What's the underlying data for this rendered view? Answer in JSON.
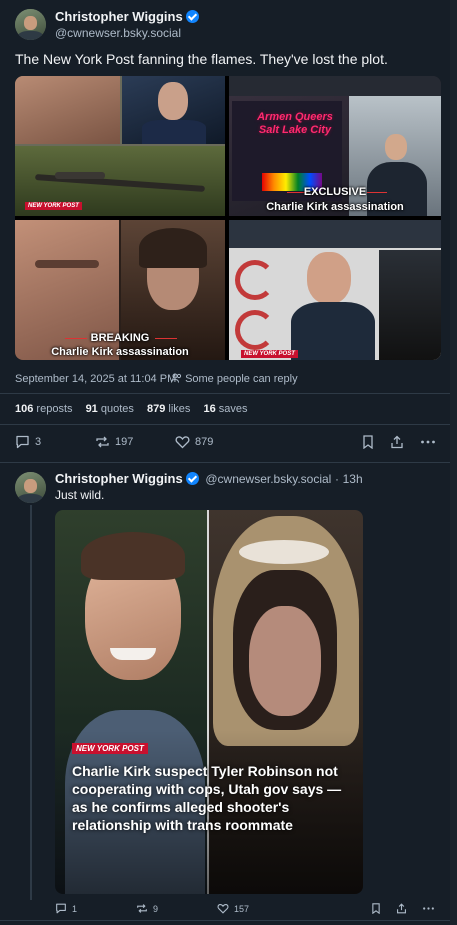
{
  "main_post": {
    "author_name": "Christopher Wiggins",
    "author_handle": "@cwnewser.bsky.social",
    "text": "The New York Post fanning the flames. They've lost the plot.",
    "images": {
      "cell2_sign_line1": "Armen Queers",
      "cell2_sign_line2": "Salt Lake City",
      "cell2_caption_label": "EXCLUSIVE",
      "cell2_caption_title": "Charlie Kirk assassination",
      "cell1_brand": "NEW YORK POST",
      "cell3_caption_label": "BREAKING",
      "cell3_caption_title": "Charlie Kirk assassination",
      "cell4_brand": "NEW YORK POST"
    },
    "timestamp": "September 14, 2025 at 11:04 PM",
    "reply_restriction": "Some people can reply",
    "stats": {
      "reposts_count": "106",
      "reposts_label": "reposts",
      "quotes_count": "91",
      "quotes_label": "quotes",
      "likes_count": "879",
      "likes_label": "likes",
      "saves_count": "16",
      "saves_label": "saves"
    },
    "actions": {
      "replies": "3",
      "reposts": "197",
      "likes": "879"
    }
  },
  "reply_post": {
    "author_name": "Christopher Wiggins",
    "author_handle": "@cwnewser.bsky.social",
    "separator": "·",
    "age": "13h",
    "text": "Just wild.",
    "image": {
      "brand": "NEW YORK POST",
      "headline": "Charlie Kirk suspect Tyler Robinson not cooperating with cops, Utah gov says — as he confirms alleged shooter's relationship with trans roommate"
    },
    "actions": {
      "replies": "1",
      "reposts": "9",
      "likes": "157"
    }
  },
  "colors": {
    "background": "#161e27",
    "accent": "#1185fe",
    "muted_text": "#aebbc9",
    "divider": "#2e3a46",
    "brand_red": "#c8102e"
  },
  "icons": [
    "verified-badge-icon",
    "people-icon",
    "reply-icon",
    "repost-icon",
    "like-icon",
    "bookmark-icon",
    "share-icon",
    "more-icon"
  ]
}
